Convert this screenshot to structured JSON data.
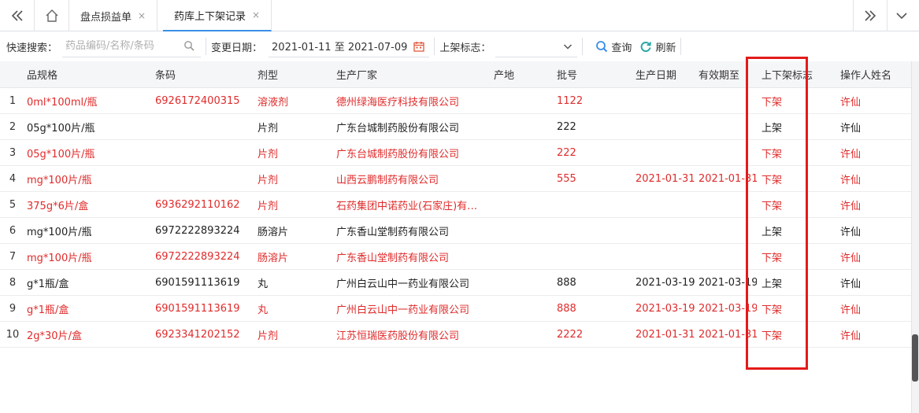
{
  "tabbar": {
    "collapse_icon": "double-chevron-left-icon",
    "home_icon": "home-icon",
    "tabs": [
      {
        "label": "盘点损益单",
        "close": "×"
      },
      {
        "label": "药库上下架记录",
        "close": "×"
      }
    ],
    "expand_icon": "double-chevron-right-icon",
    "menu_icon": "chevron-down-icon"
  },
  "toolbar": {
    "quick_search_label": "快速搜索：",
    "search_placeholder": "药品编码/名称/条码",
    "change_date_label": "变更日期：",
    "date_range": "2021-01-11 至 2021-07-09",
    "shelf_flag_label": "上架标志：",
    "shelf_flag_value": "",
    "query_label": "查询",
    "refresh_label": "刷新"
  },
  "table": {
    "headers": {
      "spec": "品规格",
      "barcode": "条码",
      "form": "剂型",
      "manufacturer": "生产厂家",
      "origin": "产地",
      "batch": "批号",
      "prod_date": "生产日期",
      "expiry": "有效期至",
      "shelf_flag": "上下架标志",
      "operator": "操作人姓名"
    },
    "rows": [
      {
        "idx": "1",
        "spec": "0ml*100ml/瓶",
        "barcode": "6926172400315",
        "form": "溶液剂",
        "manufacturer": "德州绿海医疗科技有限公司",
        "origin": "",
        "batch": "1122",
        "prod_date": "",
        "expiry": "",
        "shelf_flag": "下架",
        "operator": "许仙",
        "red": true
      },
      {
        "idx": "2",
        "spec": "05g*100片/瓶",
        "barcode": "",
        "form": "片剂",
        "manufacturer": "广东台城制药股份有限公司",
        "origin": "",
        "batch": "222",
        "prod_date": "",
        "expiry": "",
        "shelf_flag": "上架",
        "operator": "许仙",
        "red": false
      },
      {
        "idx": "3",
        "spec": "05g*100片/瓶",
        "barcode": "",
        "form": "片剂",
        "manufacturer": "广东台城制药股份有限公司",
        "origin": "",
        "batch": "222",
        "prod_date": "",
        "expiry": "",
        "shelf_flag": "下架",
        "operator": "许仙",
        "red": true
      },
      {
        "idx": "4",
        "spec": "mg*100片/瓶",
        "barcode": "",
        "form": "片剂",
        "manufacturer": "山西云鹏制药有限公司",
        "origin": "",
        "batch": "555",
        "prod_date": "2021-01-31",
        "expiry": "2021-01-31",
        "shelf_flag": "下架",
        "operator": "许仙",
        "red": true
      },
      {
        "idx": "5",
        "spec": "375g*6片/盒",
        "barcode": "6936292110162",
        "form": "片剂",
        "manufacturer": "石药集团中诺药业(石家庄)有…",
        "origin": "",
        "batch": "",
        "prod_date": "",
        "expiry": "",
        "shelf_flag": "下架",
        "operator": "许仙",
        "red": true
      },
      {
        "idx": "6",
        "spec": "mg*100片/瓶",
        "barcode": "6972222893224",
        "form": "肠溶片",
        "manufacturer": "广东香山堂制药有限公司",
        "origin": "",
        "batch": "",
        "prod_date": "",
        "expiry": "",
        "shelf_flag": "上架",
        "operator": "许仙",
        "red": false
      },
      {
        "idx": "7",
        "spec": "mg*100片/瓶",
        "barcode": "6972222893224",
        "form": "肠溶片",
        "manufacturer": "广东香山堂制药有限公司",
        "origin": "",
        "batch": "",
        "prod_date": "",
        "expiry": "",
        "shelf_flag": "下架",
        "operator": "许仙",
        "red": true
      },
      {
        "idx": "8",
        "spec": "g*1瓶/盒",
        "barcode": "6901591113619",
        "form": "丸",
        "manufacturer": "广州白云山中一药业有限公司",
        "origin": "",
        "batch": "888",
        "prod_date": "2021-03-19",
        "expiry": "2021-03-19",
        "shelf_flag": "上架",
        "operator": "许仙",
        "red": false
      },
      {
        "idx": "9",
        "spec": "g*1瓶/盒",
        "barcode": "6901591113619",
        "form": "丸",
        "manufacturer": "广州白云山中一药业有限公司",
        "origin": "",
        "batch": "888",
        "prod_date": "2021-03-19",
        "expiry": "2021-03-19",
        "shelf_flag": "下架",
        "operator": "许仙",
        "red": true
      },
      {
        "idx": "10",
        "spec": "2g*30片/盒",
        "barcode": "6923341202152",
        "form": "片剂",
        "manufacturer": "江苏恒瑞医药股份有限公司",
        "origin": "",
        "batch": "2222",
        "prod_date": "2021-01-31",
        "expiry": "2021-01-31",
        "shelf_flag": "下架",
        "operator": "许仙",
        "red": true
      }
    ]
  },
  "colors": {
    "down_row_text": "#e02b2b",
    "highlight_box": "#e31b1b",
    "active_tab_accent": "#3a8ee6",
    "icon_blue": "#3a8ee6",
    "refresh_teal": "#2aa5a5",
    "calendar_red": "#e05a3a"
  }
}
